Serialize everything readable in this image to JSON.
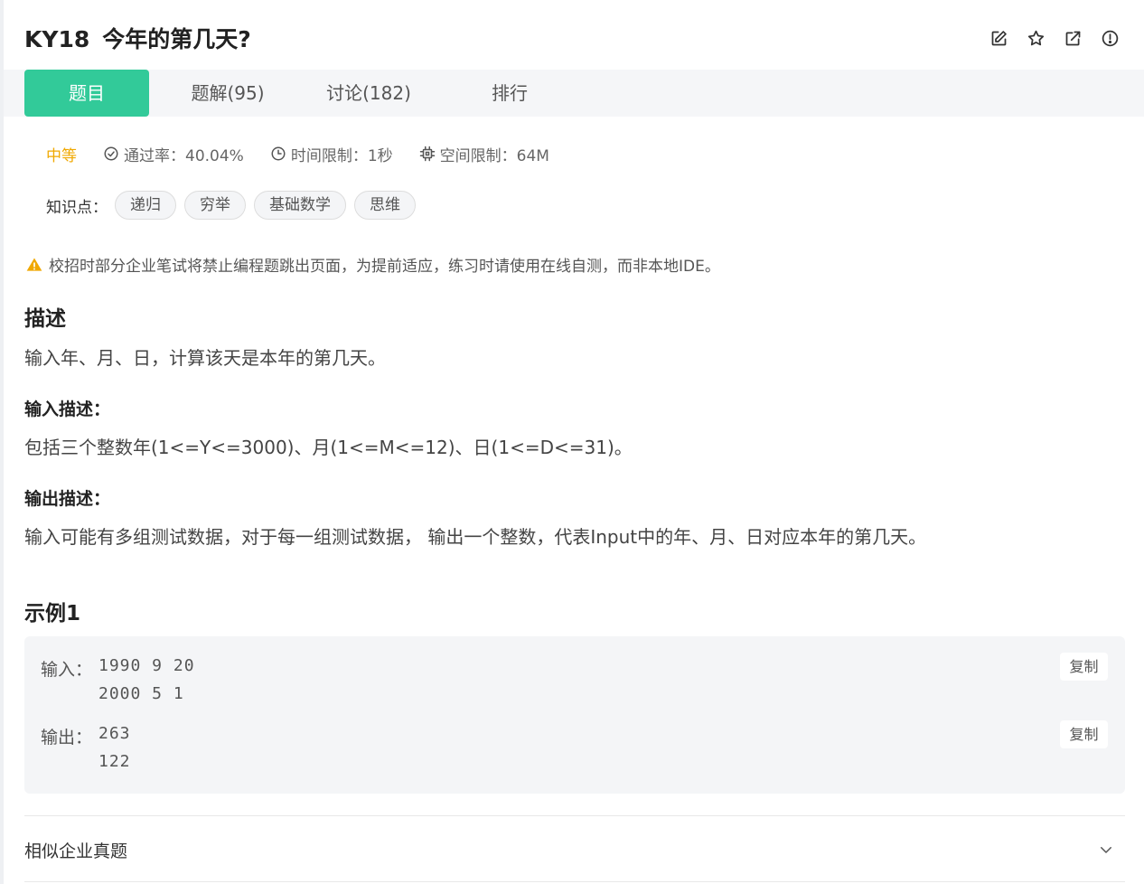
{
  "header": {
    "id": "KY18",
    "title": "今年的第几天?",
    "icons": [
      "edit-icon",
      "star-icon",
      "open-external-icon",
      "report-icon"
    ]
  },
  "tabs": [
    {
      "label": "题目",
      "active": true
    },
    {
      "label": "题解(95)",
      "active": false
    },
    {
      "label": "讨论(182)",
      "active": false
    },
    {
      "label": "排行",
      "active": false
    }
  ],
  "meta": {
    "difficulty": "中等",
    "pass_rate": "通过率：40.04%",
    "time_limit": "时间限制：1秒",
    "space_limit": "空间限制：64M"
  },
  "knowledge": {
    "label": "知识点：",
    "tags": [
      "递归",
      "穷举",
      "基础数学",
      "思维"
    ]
  },
  "warning": "校招时部分企业笔试将禁止编程题跳出页面，为提前适应，练习时请使用在线自测，而非本地IDE。",
  "description": {
    "heading": "描述",
    "text": "输入年、月、日，计算该天是本年的第几天。"
  },
  "input_desc": {
    "heading": "输入描述：",
    "text": "包括三个整数年(1<=Y<=3000)、月(1<=M<=12)、日(1<=D<=31)。"
  },
  "output_desc": {
    "heading": "输出描述：",
    "text": "输入可能有多组测试数据，对于每一组测试数据， 输出一个整数，代表Input中的年、月、日对应本年的第几天。"
  },
  "example": {
    "heading": "示例1",
    "input_label": "输入：",
    "input_lines": [
      "1990 9 20",
      "2000 5 1"
    ],
    "output_label": "输出：",
    "output_lines": [
      "263",
      "122"
    ],
    "copy_label": "复制"
  },
  "similar": {
    "label": "相似企业真题"
  },
  "colors": {
    "accent": "#32ca99",
    "difficulty": "#f0a800",
    "warning": "#f0a800"
  }
}
